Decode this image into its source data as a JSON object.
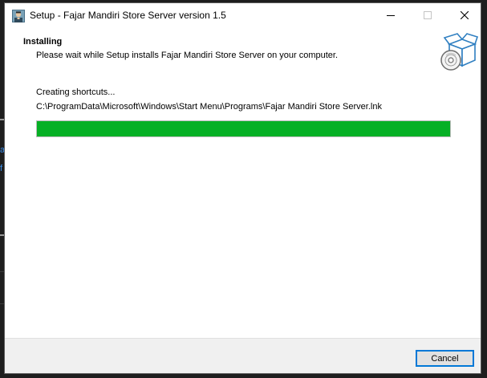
{
  "window": {
    "title": "Setup - Fajar Mandiri Store Server version 1.5"
  },
  "header": {
    "title": "Installing",
    "subtitle": "Please wait while Setup installs Fajar Mandiri Store Server on your computer."
  },
  "content": {
    "status_text": "Creating shortcuts...",
    "current_file": "C:\\ProgramData\\Microsoft\\Windows\\Start Menu\\Programs\\Fajar Mandiri Store Server.lnk",
    "progress_fraction": 1.0
  },
  "footer": {
    "cancel_label": "Cancel"
  },
  "colors": {
    "progress_fill": "#06b025",
    "button_focus_border": "#0078d7",
    "footer_bg": "#f0f0f0"
  },
  "icons": {
    "app": "app-icon",
    "setup_box": "setup-box-icon",
    "minimize": "minimize-icon",
    "maximize": "maximize-icon",
    "close": "close-icon"
  }
}
